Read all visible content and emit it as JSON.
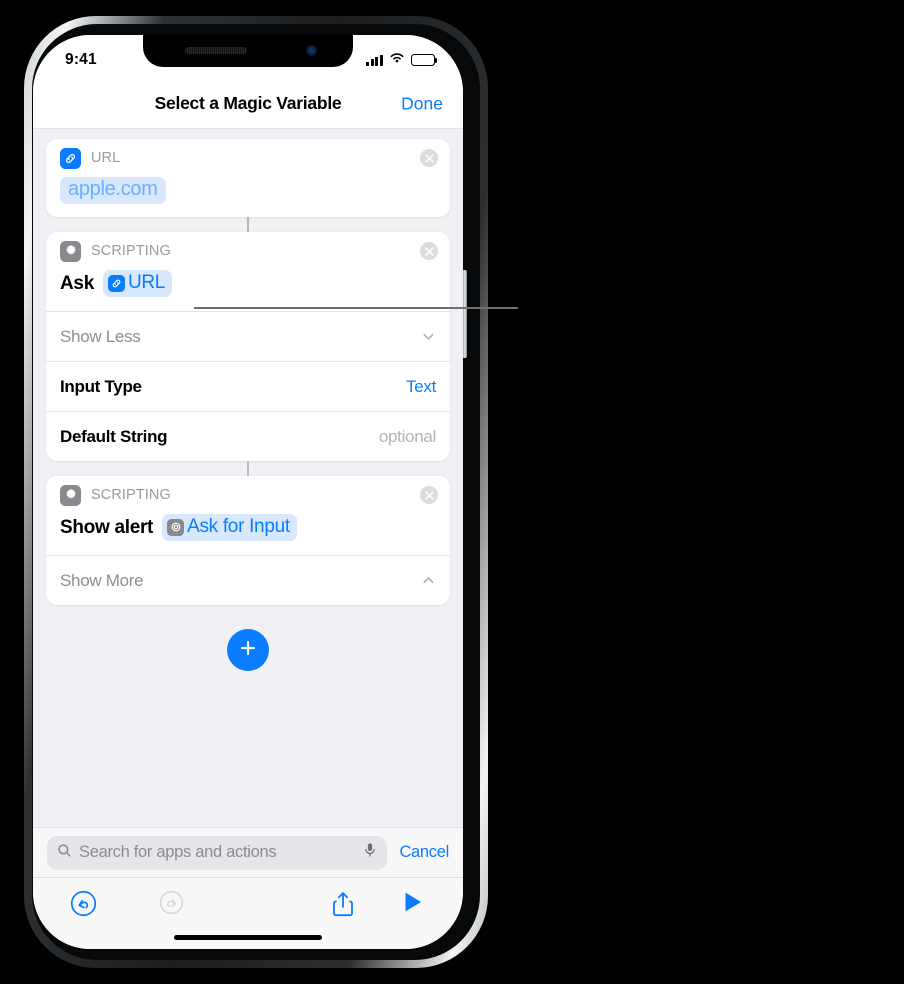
{
  "status_bar": {
    "time": "9:41",
    "signal_icon": "signal-bars-icon",
    "wifi_icon": "wifi-icon",
    "battery_icon": "battery-icon"
  },
  "nav": {
    "title": "Select a Magic Variable",
    "done_label": "Done"
  },
  "cards": {
    "url_card": {
      "icon": "link-icon",
      "category": "URL",
      "close_icon": "close-circle-icon",
      "value_pill": "apple.com"
    },
    "ask_card": {
      "icon": "gear-icon",
      "category": "SCRIPTING",
      "close_icon": "close-circle-icon",
      "action_label": "Ask",
      "token_icon": "link-icon",
      "token_label": "URL",
      "show_less_label": "Show Less",
      "show_less_icon": "chevron-down-icon",
      "rows": [
        {
          "label": "Input Type",
          "value": "Text",
          "is_placeholder": false
        },
        {
          "label": "Default String",
          "value": "optional",
          "is_placeholder": true
        }
      ]
    },
    "alert_card": {
      "icon": "gear-icon",
      "category": "SCRIPTING",
      "close_icon": "close-circle-icon",
      "action_label": "Show alert",
      "token_icon": "gear-icon",
      "token_label": "Ask for Input",
      "show_more_label": "Show More",
      "show_more_icon": "chevron-up-icon"
    }
  },
  "add_button": {
    "icon": "plus-icon"
  },
  "search": {
    "placeholder": "Search for apps and actions",
    "search_icon": "search-icon",
    "mic_icon": "microphone-icon",
    "cancel_label": "Cancel"
  },
  "toolbar": {
    "undo_icon": "undo-icon",
    "redo_icon": "redo-icon",
    "share_icon": "share-icon",
    "run_icon": "play-icon"
  },
  "colors": {
    "accent": "#0a7cff",
    "token_bg": "#d7e8fd",
    "screen_bg": "#f1f1f5",
    "muted": "#8e8e93",
    "disabled": "#c6c6cb"
  }
}
